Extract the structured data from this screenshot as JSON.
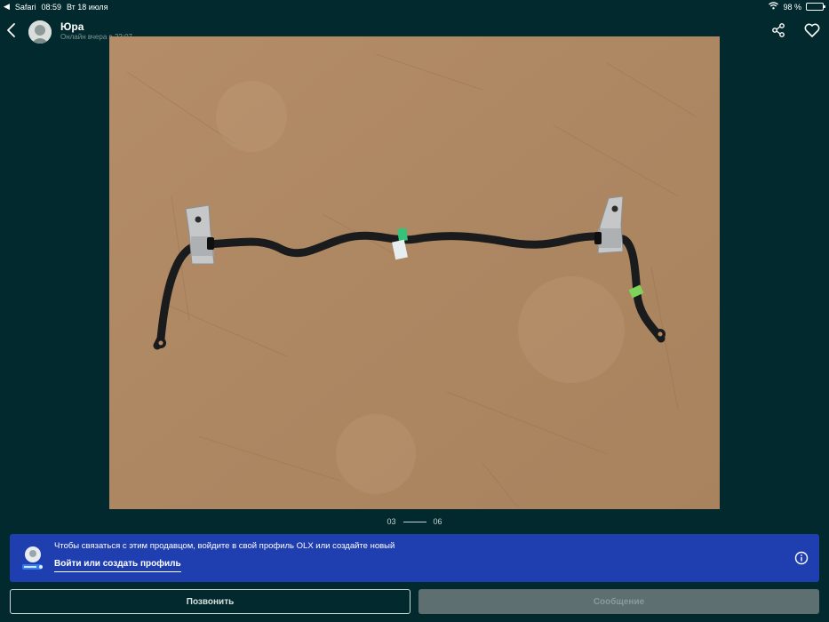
{
  "status_bar": {
    "app": "Safari",
    "time": "08:59",
    "date": "Вт 18 июля",
    "battery": "98 %",
    "battery_level": 0.98
  },
  "header": {
    "seller_name": "Юра",
    "seller_status": "Онлайн вчера в 22:07"
  },
  "gallery": {
    "current": "03",
    "total": "06"
  },
  "login_banner": {
    "message": "Чтобы связаться с этим продавцом, войдите в свой профиль OLX или создайте новый",
    "link_label": "Войти или создать профиль"
  },
  "actions": {
    "call_label": "Позвонить",
    "message_label": "Сообщение"
  },
  "colors": {
    "background": "#022a2e",
    "banner": "#1f3fb0",
    "photo_floor": "#b08a65"
  }
}
